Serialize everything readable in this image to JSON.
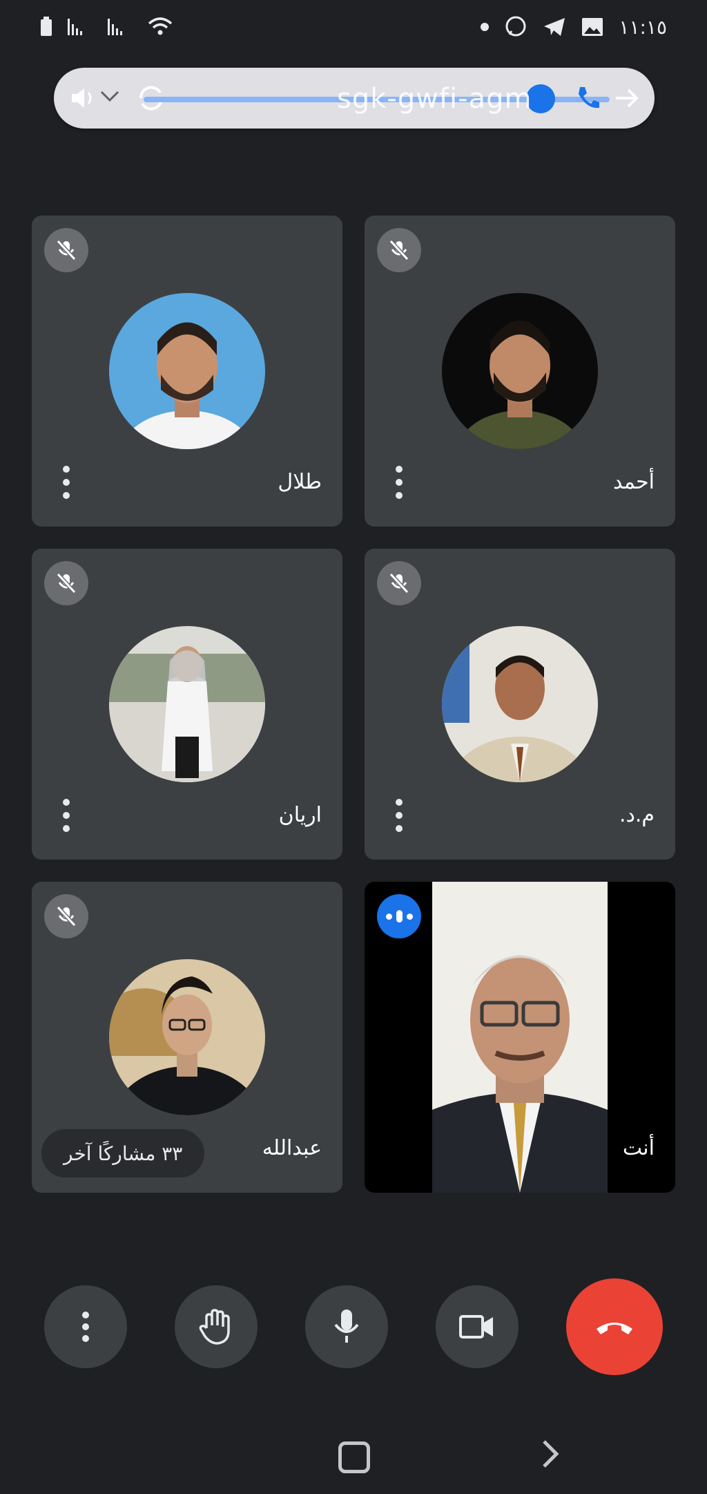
{
  "status_bar": {
    "time": "١١:١٥"
  },
  "top_bar": {
    "meeting_code": "sgk-gwfi-agm",
    "volume_level": 0.8
  },
  "tiles": [
    {
      "name": "أحمد",
      "muted": true
    },
    {
      "name": "طلال",
      "muted": true
    },
    {
      "name": "م.د.",
      "muted": true
    },
    {
      "name": "اريان",
      "muted": true
    },
    {
      "name": "أنت",
      "muted": false,
      "speaking": true
    },
    {
      "name": "عبدالله",
      "muted": true
    }
  ],
  "others_chip": "٣٣ مشاركًا آخر",
  "colors": {
    "background": "#1f2023",
    "tile": "#3c4043",
    "accent": "#1a73e8",
    "end_call": "#ea4335"
  },
  "controls": {
    "icons": [
      "more-vert-icon",
      "raise-hand-icon",
      "mic-icon",
      "videocam-icon",
      "call-end-icon"
    ]
  }
}
